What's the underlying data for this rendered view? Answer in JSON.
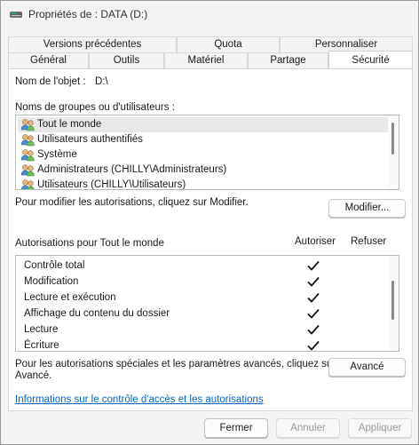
{
  "window": {
    "title": "Propriétés de : DATA (D:)"
  },
  "tabs": {
    "row1": [
      {
        "label": "Versions précédentes"
      },
      {
        "label": "Quota"
      },
      {
        "label": "Personnaliser"
      }
    ],
    "row2": [
      {
        "label": "Général"
      },
      {
        "label": "Outils"
      },
      {
        "label": "Matériel"
      },
      {
        "label": "Partage"
      },
      {
        "label": "Sécurité",
        "active": true
      }
    ]
  },
  "object": {
    "label": "Nom de l'objet :",
    "value": "D:\\"
  },
  "groups": {
    "label": "Noms de groupes ou d'utilisateurs :",
    "items": [
      {
        "label": "Tout le monde",
        "icon": "users-icon",
        "selected": true
      },
      {
        "label": "Utilisateurs authentifiés",
        "icon": "users-icon"
      },
      {
        "label": "Système",
        "icon": "users-icon"
      },
      {
        "label": "Administrateurs (CHILLY\\Administrateurs)",
        "icon": "users-icon"
      },
      {
        "label": "Utilisateurs (CHILLY\\Utilisateurs)",
        "icon": "users-icon"
      }
    ]
  },
  "modify": {
    "hint": "Pour modifier les autorisations, cliquez sur Modifier.",
    "button": "Modifier..."
  },
  "permissions": {
    "title": "Autorisations pour Tout le monde",
    "col_allow": "Autoriser",
    "col_deny": "Refuser",
    "items": [
      {
        "label": "Contrôle total",
        "allow": true,
        "deny": false
      },
      {
        "label": "Modification",
        "allow": true,
        "deny": false
      },
      {
        "label": "Lecture et exécution",
        "allow": true,
        "deny": false
      },
      {
        "label": "Affichage du contenu du dossier",
        "allow": true,
        "deny": false
      },
      {
        "label": "Lecture",
        "allow": true,
        "deny": false
      },
      {
        "label": "Écriture",
        "allow": true,
        "deny": false
      }
    ]
  },
  "advanced": {
    "hint_line1": "Pour les autorisations spéciales et les paramètres avancés, cliquez sur",
    "hint_line2": "Avancé.",
    "button": "Avancé"
  },
  "info_link": "Informations sur le contrôle d'accès et les autorisations",
  "footer": {
    "close": "Fermer",
    "cancel": "Annuler",
    "apply": "Appliquer"
  }
}
